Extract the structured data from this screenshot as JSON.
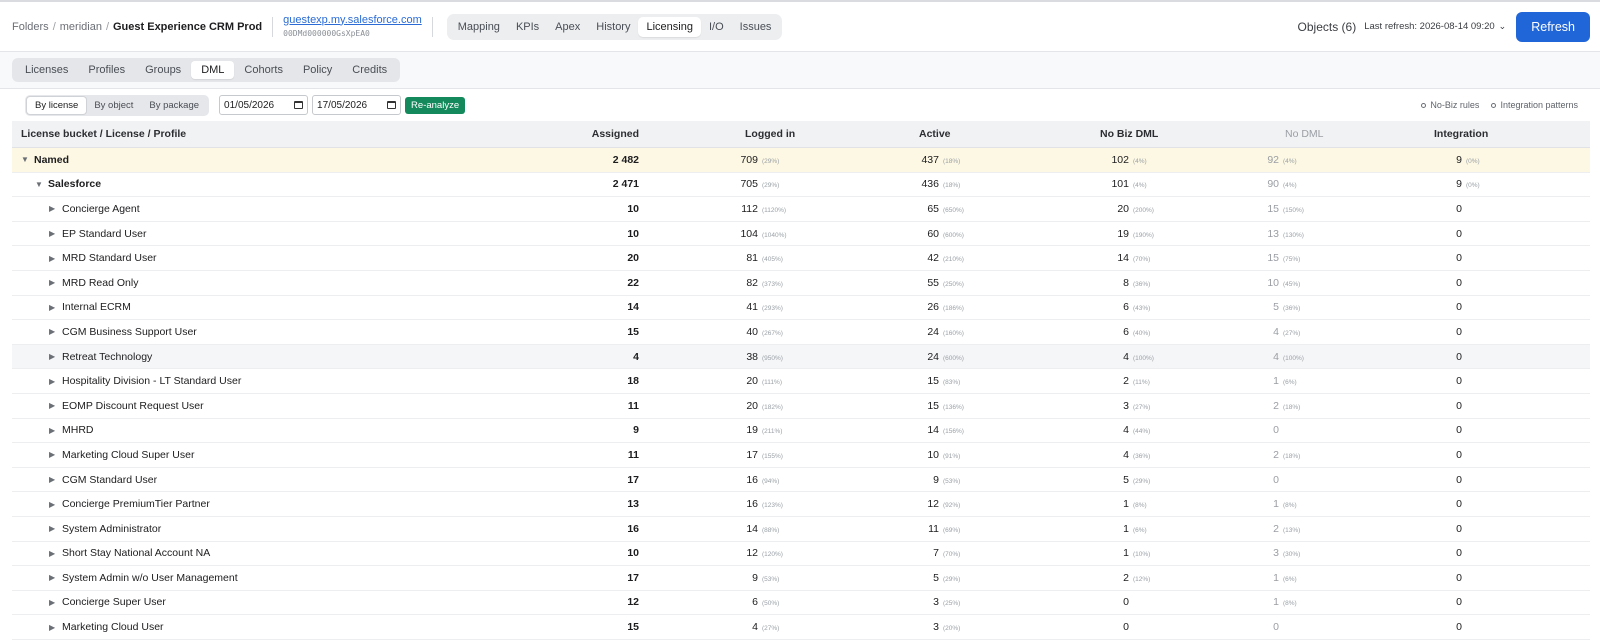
{
  "breadcrumb": {
    "folders": "Folders",
    "sep1": "/",
    "workspace": "meridian",
    "sep2": "/",
    "current": "Guest Experience CRM Prod"
  },
  "org": {
    "link": "guestexp.my.salesforce.com",
    "id": "00DMd000000GsXpEA0"
  },
  "nav_tabs": [
    {
      "label": "Mapping",
      "active": false
    },
    {
      "label": "KPIs",
      "active": false
    },
    {
      "label": "Apex",
      "active": false
    },
    {
      "label": "History",
      "active": false
    },
    {
      "label": "Licensing",
      "active": true
    },
    {
      "label": "I/O",
      "active": false
    },
    {
      "label": "Issues",
      "active": false
    }
  ],
  "header_right": {
    "objects": "Objects (6)",
    "last_refresh": "Last refresh: 2026-08-14 09:20",
    "refresh_label": "Refresh"
  },
  "colors": {
    "accent": "#2166d9",
    "reanalyze": "#148a5c",
    "group_row": "#fdf8e3"
  },
  "sub_tabs": [
    {
      "label": "Licenses",
      "active": false
    },
    {
      "label": "Profiles",
      "active": false
    },
    {
      "label": "Groups",
      "active": false
    },
    {
      "label": "DML",
      "active": true
    },
    {
      "label": "Cohorts",
      "active": false
    },
    {
      "label": "Policy",
      "active": false
    },
    {
      "label": "Credits",
      "active": false
    }
  ],
  "toolbar": {
    "views": [
      {
        "label": "By license",
        "active": true
      },
      {
        "label": "By object",
        "active": false
      },
      {
        "label": "By package",
        "active": false
      }
    ],
    "date_from": "01/05/2026",
    "date_to": "17/05/2026",
    "reanalyze_label": "Re-analyze",
    "no_biz_rules": "No-Biz rules",
    "integration_patterns": "Integration patterns"
  },
  "table": {
    "headers": {
      "name": "License bucket / License / Profile",
      "assigned": "Assigned",
      "logged_in": "Logged in",
      "active": "Active",
      "no_biz_dml": "No Biz DML",
      "no_dml": "No DML",
      "integration": "Integration"
    },
    "rows": [
      {
        "level": 1,
        "caret": "▼",
        "name": "Named",
        "assigned": "2 482",
        "logged": "709",
        "logged_pct": "(29%)",
        "active": "437",
        "active_pct": "(18%)",
        "nobiz": "102",
        "nobiz_pct": "(4%)",
        "nodml": "92",
        "nodml_pct": "(4%)",
        "integ": "9",
        "integ_pct": "(0%)"
      },
      {
        "level": 2,
        "caret": "▼",
        "name": "Salesforce",
        "assigned": "2 471",
        "logged": "705",
        "logged_pct": "(29%)",
        "active": "436",
        "active_pct": "(18%)",
        "nobiz": "101",
        "nobiz_pct": "(4%)",
        "nodml": "90",
        "nodml_pct": "(4%)",
        "integ": "9",
        "integ_pct": "(0%)"
      },
      {
        "level": 3,
        "caret": "▶",
        "name": "Concierge Agent",
        "assigned": "10",
        "logged": "112",
        "logged_pct": "(1120%)",
        "active": "65",
        "active_pct": "(650%)",
        "nobiz": "20",
        "nobiz_pct": "(200%)",
        "nodml": "15",
        "nodml_pct": "(150%)",
        "integ": "0",
        "integ_pct": ""
      },
      {
        "level": 3,
        "caret": "▶",
        "name": "EP Standard User",
        "assigned": "10",
        "logged": "104",
        "logged_pct": "(1040%)",
        "active": "60",
        "active_pct": "(600%)",
        "nobiz": "19",
        "nobiz_pct": "(190%)",
        "nodml": "13",
        "nodml_pct": "(130%)",
        "integ": "0",
        "integ_pct": ""
      },
      {
        "level": 3,
        "caret": "▶",
        "name": "MRD Standard User",
        "assigned": "20",
        "logged": "81",
        "logged_pct": "(405%)",
        "active": "42",
        "active_pct": "(210%)",
        "nobiz": "14",
        "nobiz_pct": "(70%)",
        "nodml": "15",
        "nodml_pct": "(75%)",
        "integ": "0",
        "integ_pct": ""
      },
      {
        "level": 3,
        "caret": "▶",
        "name": "MRD Read Only",
        "assigned": "22",
        "logged": "82",
        "logged_pct": "(373%)",
        "active": "55",
        "active_pct": "(250%)",
        "nobiz": "8",
        "nobiz_pct": "(36%)",
        "nodml": "10",
        "nodml_pct": "(45%)",
        "integ": "0",
        "integ_pct": ""
      },
      {
        "level": 3,
        "caret": "▶",
        "name": "Internal ECRM",
        "assigned": "14",
        "logged": "41",
        "logged_pct": "(293%)",
        "active": "26",
        "active_pct": "(186%)",
        "nobiz": "6",
        "nobiz_pct": "(43%)",
        "nodml": "5",
        "nodml_pct": "(36%)",
        "integ": "0",
        "integ_pct": ""
      },
      {
        "level": 3,
        "caret": "▶",
        "name": "CGM Business Support User",
        "assigned": "15",
        "logged": "40",
        "logged_pct": "(267%)",
        "active": "24",
        "active_pct": "(160%)",
        "nobiz": "6",
        "nobiz_pct": "(40%)",
        "nodml": "4",
        "nodml_pct": "(27%)",
        "integ": "0",
        "integ_pct": ""
      },
      {
        "level": 3,
        "caret": "▶",
        "name": "Retreat Technology",
        "assigned": "4",
        "logged": "38",
        "logged_pct": "(950%)",
        "active": "24",
        "active_pct": "(600%)",
        "nobiz": "4",
        "nobiz_pct": "(100%)",
        "nodml": "4",
        "nodml_pct": "(100%)",
        "integ": "0",
        "integ_pct": "",
        "highlight": true
      },
      {
        "level": 3,
        "caret": "▶",
        "name": "Hospitality Division - LT Standard User",
        "assigned": "18",
        "logged": "20",
        "logged_pct": "(111%)",
        "active": "15",
        "active_pct": "(83%)",
        "nobiz": "2",
        "nobiz_pct": "(11%)",
        "nodml": "1",
        "nodml_pct": "(6%)",
        "integ": "0",
        "integ_pct": ""
      },
      {
        "level": 3,
        "caret": "▶",
        "name": "EOMP Discount Request User",
        "assigned": "11",
        "logged": "20",
        "logged_pct": "(182%)",
        "active": "15",
        "active_pct": "(136%)",
        "nobiz": "3",
        "nobiz_pct": "(27%)",
        "nodml": "2",
        "nodml_pct": "(18%)",
        "integ": "0",
        "integ_pct": ""
      },
      {
        "level": 3,
        "caret": "▶",
        "name": "MHRD",
        "assigned": "9",
        "logged": "19",
        "logged_pct": "(211%)",
        "active": "14",
        "active_pct": "(156%)",
        "nobiz": "4",
        "nobiz_pct": "(44%)",
        "nodml": "0",
        "nodml_pct": "",
        "integ": "0",
        "integ_pct": ""
      },
      {
        "level": 3,
        "caret": "▶",
        "name": "Marketing Cloud Super User",
        "assigned": "11",
        "logged": "17",
        "logged_pct": "(155%)",
        "active": "10",
        "active_pct": "(91%)",
        "nobiz": "4",
        "nobiz_pct": "(36%)",
        "nodml": "2",
        "nodml_pct": "(18%)",
        "integ": "0",
        "integ_pct": ""
      },
      {
        "level": 3,
        "caret": "▶",
        "name": "CGM Standard User",
        "assigned": "17",
        "logged": "16",
        "logged_pct": "(94%)",
        "active": "9",
        "active_pct": "(53%)",
        "nobiz": "5",
        "nobiz_pct": "(29%)",
        "nodml": "0",
        "nodml_pct": "",
        "integ": "0",
        "integ_pct": ""
      },
      {
        "level": 3,
        "caret": "▶",
        "name": "Concierge PremiumTier Partner",
        "assigned": "13",
        "logged": "16",
        "logged_pct": "(123%)",
        "active": "12",
        "active_pct": "(92%)",
        "nobiz": "1",
        "nobiz_pct": "(8%)",
        "nodml": "1",
        "nodml_pct": "(8%)",
        "integ": "0",
        "integ_pct": ""
      },
      {
        "level": 3,
        "caret": "▶",
        "name": "System Administrator",
        "assigned": "16",
        "logged": "14",
        "logged_pct": "(88%)",
        "active": "11",
        "active_pct": "(69%)",
        "nobiz": "1",
        "nobiz_pct": "(6%)",
        "nodml": "2",
        "nodml_pct": "(13%)",
        "integ": "0",
        "integ_pct": ""
      },
      {
        "level": 3,
        "caret": "▶",
        "name": "Short Stay National Account NA",
        "assigned": "10",
        "logged": "12",
        "logged_pct": "(120%)",
        "active": "7",
        "active_pct": "(70%)",
        "nobiz": "1",
        "nobiz_pct": "(10%)",
        "nodml": "3",
        "nodml_pct": "(30%)",
        "integ": "0",
        "integ_pct": ""
      },
      {
        "level": 3,
        "caret": "▶",
        "name": "System Admin w/o User Management",
        "assigned": "17",
        "logged": "9",
        "logged_pct": "(53%)",
        "active": "5",
        "active_pct": "(29%)",
        "nobiz": "2",
        "nobiz_pct": "(12%)",
        "nodml": "1",
        "nodml_pct": "(6%)",
        "integ": "0",
        "integ_pct": ""
      },
      {
        "level": 3,
        "caret": "▶",
        "name": "Concierge Super User",
        "assigned": "12",
        "logged": "6",
        "logged_pct": "(50%)",
        "active": "3",
        "active_pct": "(25%)",
        "nobiz": "0",
        "nobiz_pct": "",
        "nodml": "1",
        "nodml_pct": "(8%)",
        "integ": "0",
        "integ_pct": ""
      },
      {
        "level": 3,
        "caret": "▶",
        "name": "Marketing Cloud User",
        "assigned": "15",
        "logged": "4",
        "logged_pct": "(27%)",
        "active": "3",
        "active_pct": "(20%)",
        "nobiz": "0",
        "nobiz_pct": "",
        "nodml": "0",
        "nodml_pct": "",
        "integ": "0",
        "integ_pct": ""
      }
    ]
  }
}
